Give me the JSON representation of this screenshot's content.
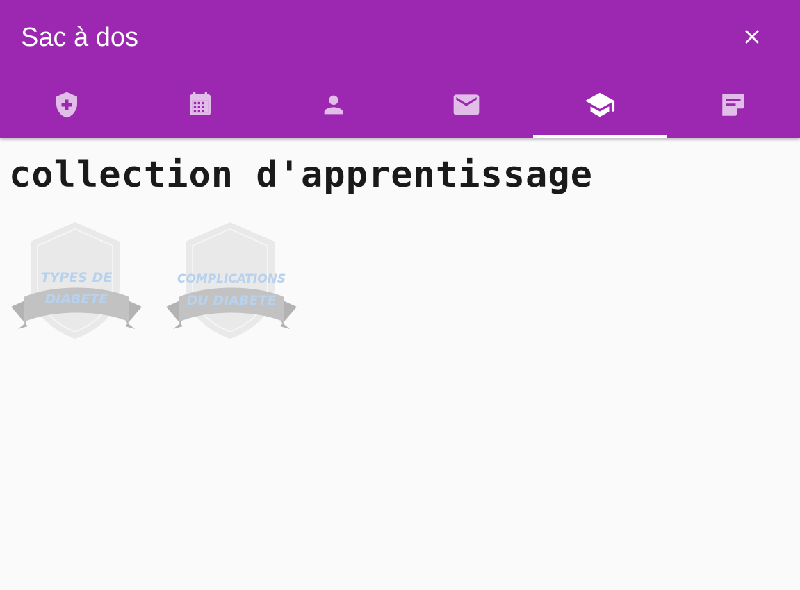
{
  "header": {
    "title": "Sac à dos",
    "close_icon": "close-icon"
  },
  "tabs": [
    {
      "icon": "shield-plus-icon",
      "active": false
    },
    {
      "icon": "calendar-icon",
      "active": false
    },
    {
      "icon": "person-icon",
      "active": false
    },
    {
      "icon": "mail-icon",
      "active": false
    },
    {
      "icon": "school-icon",
      "active": true
    },
    {
      "icon": "note-edit-icon",
      "active": false
    }
  ],
  "main": {
    "title": "collection d'apprentissage",
    "badges": [
      {
        "line1": "TYPES DE",
        "line2": "DIABETE"
      },
      {
        "line1": "COMPLICATIONS",
        "line2": "DU DIABETE"
      }
    ]
  },
  "colors": {
    "primary": "#9c27b0",
    "tab_icon_inactive": "#e1bee7",
    "tab_icon_active": "#ffffff",
    "badge_text": "#b7d2ee"
  }
}
